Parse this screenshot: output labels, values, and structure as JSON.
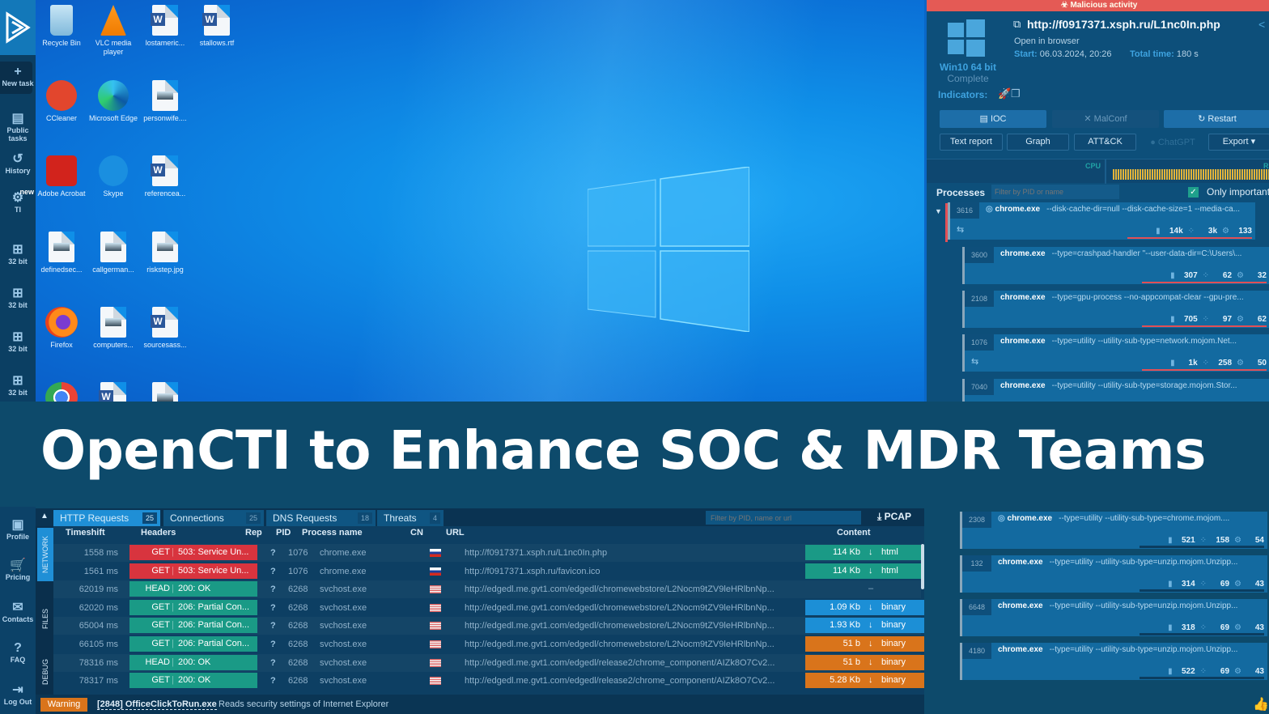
{
  "sidebar": {
    "items": [
      {
        "label": "New task",
        "icon": "plus-icon"
      },
      {
        "label": "Public tasks",
        "icon": "document-icon"
      },
      {
        "label": "History",
        "icon": "history-icon"
      },
      {
        "label": "TI",
        "badge": "new",
        "icon": "ti-icon"
      },
      {
        "label": "32 bit",
        "icon": "windows-icon"
      },
      {
        "label": "32 bit",
        "icon": "windows-icon"
      },
      {
        "label": "32 bit",
        "icon": "windows-icon"
      },
      {
        "label": "32 bit",
        "icon": "windows-icon"
      }
    ],
    "bottom_items": [
      {
        "label": "Profile",
        "icon": "profile-icon"
      },
      {
        "label": "Pricing",
        "icon": "cart-icon"
      },
      {
        "label": "Contacts",
        "icon": "mail-icon"
      },
      {
        "label": "FAQ",
        "icon": "help-icon"
      },
      {
        "label": "Log Out",
        "icon": "logout-icon"
      }
    ]
  },
  "desktop": {
    "icons": [
      {
        "label": "Recycle Bin",
        "type": "recycle"
      },
      {
        "label": "VLC media player",
        "type": "vlc"
      },
      {
        "label": "lostameric...",
        "type": "word"
      },
      {
        "label": "stallows.rtf",
        "type": "word"
      },
      {
        "label": "CCleaner",
        "type": "ccleaner"
      },
      {
        "label": "Microsoft Edge",
        "type": "edge"
      },
      {
        "label": "personwife....",
        "type": "image"
      },
      {
        "label": "Adobe Acrobat",
        "type": "acrobat"
      },
      {
        "label": "Skype",
        "type": "skype"
      },
      {
        "label": "referencea...",
        "type": "word"
      },
      {
        "label": "definedsec...",
        "type": "image"
      },
      {
        "label": "callgerman...",
        "type": "image"
      },
      {
        "label": "riskstep.jpg",
        "type": "image"
      },
      {
        "label": "Firefox",
        "type": "firefox"
      },
      {
        "label": "computers...",
        "type": "image"
      },
      {
        "label": "sourcesass...",
        "type": "word"
      },
      {
        "label": "",
        "type": "chrome"
      },
      {
        "label": "",
        "type": "word"
      },
      {
        "label": "",
        "type": "image"
      }
    ]
  },
  "task": {
    "verdict": "Malicious activity",
    "url": "http://f0917371.xsph.ru/L1nc0In.php",
    "action": "Open in browser",
    "start_label": "Start:",
    "start_value": "06.03.2024, 20:26",
    "total_label": "Total time:",
    "total_value": "180 s",
    "os": "Win10 64 bit",
    "status": "Complete",
    "indicators_label": "Indicators:",
    "buttons": {
      "ioc": "IOC",
      "malconf": "MalConf",
      "restart": "Restart",
      "text_report": "Text report",
      "graph": "Graph",
      "attck": "ATT&CK",
      "chatgpt": "ChatGPT",
      "export": "Export"
    },
    "cpu_label": "CPU",
    "ram_label": "RA"
  },
  "processes": {
    "title": "Processes",
    "filter_placeholder": "Filter by PID or name",
    "only_important_label": "Only important",
    "only_important_checked": true,
    "items": [
      {
        "pid": "3616",
        "name": "chrome.exe",
        "args": "--disk-cache-dir=null --disk-cache-size=1 --media-ca...",
        "files": "14k",
        "reg": "3k",
        "mods": "133"
      },
      {
        "pid": "3600",
        "name": "chrome.exe",
        "args": "--type=crashpad-handler \"--user-data-dir=C:\\Users\\...",
        "files": "307",
        "reg": "62",
        "mods": "32"
      },
      {
        "pid": "2108",
        "name": "chrome.exe",
        "args": "--type=gpu-process --no-appcompat-clear --gpu-pre...",
        "files": "705",
        "reg": "97",
        "mods": "62"
      },
      {
        "pid": "1076",
        "name": "chrome.exe",
        "args": "--type=utility --utility-sub-type=network.mojom.Net...",
        "files": "1k",
        "reg": "258",
        "mods": "50"
      },
      {
        "pid": "7040",
        "name": "chrome.exe",
        "args": "--type=utility --utility-sub-type=storage.mojom.Stor..."
      },
      {
        "pid": "2308",
        "name": "chrome.exe",
        "args": "--type=utility --utility-sub-type=chrome.mojom....",
        "files": "521",
        "reg": "158",
        "mods": "54"
      },
      {
        "pid": "132",
        "name": "chrome.exe",
        "args": "--type=utility --utility-sub-type=unzip.mojom.Unzipp...",
        "files": "314",
        "reg": "69",
        "mods": "43"
      },
      {
        "pid": "6648",
        "name": "chrome.exe",
        "args": "--type=utility --utility-sub-type=unzip.mojom.Unzipp...",
        "files": "318",
        "reg": "69",
        "mods": "43"
      },
      {
        "pid": "4180",
        "name": "chrome.exe",
        "args": "--type=utility --utility-sub-type=unzip.mojom.Unzipp...",
        "files": "522",
        "reg": "69",
        "mods": "43"
      }
    ]
  },
  "headline": "OpenCTI to Enhance SOC & MDR Teams",
  "network": {
    "tabs": [
      {
        "label": "HTTP Requests",
        "count": "25"
      },
      {
        "label": "Connections",
        "count": "25"
      },
      {
        "label": "DNS Requests",
        "count": "18"
      },
      {
        "label": "Threats",
        "count": "4"
      }
    ],
    "side_tabs": [
      "NETWORK",
      "FILES",
      "DEBUG"
    ],
    "filter_placeholder": "Filter by PID, name or url",
    "pcap_label": "PCAP",
    "columns": [
      "Timeshift",
      "Headers",
      "Rep",
      "PID",
      "Process name",
      "CN",
      "URL",
      "Content"
    ],
    "rows": [
      {
        "time": "1558 ms",
        "method": "GET",
        "status": "503: Service Un...",
        "rep": "?",
        "pid": "1076",
        "process": "chrome.exe",
        "cn": "RU",
        "url": "http://f0917371.xsph.ru/L1nc0In.php",
        "size": "114 Kb",
        "type": "html",
        "level": "danger",
        "content_level": "ok"
      },
      {
        "time": "1561 ms",
        "method": "GET",
        "status": "503: Service Un...",
        "rep": "?",
        "pid": "1076",
        "process": "chrome.exe",
        "cn": "RU",
        "url": "http://f0917371.xsph.ru/favicon.ico",
        "size": "114 Kb",
        "type": "html",
        "level": "danger",
        "content_level": "ok"
      },
      {
        "time": "62019 ms",
        "method": "HEAD",
        "status": "200: OK",
        "rep": "?",
        "pid": "6268",
        "process": "svchost.exe",
        "cn": "US",
        "url": "http://edgedl.me.gvt1.com/edgedl/chromewebstore/L2Nocm9tZV9leHRlbnNp...",
        "size": "",
        "type": "–",
        "level": "ok",
        "content_level": "none"
      },
      {
        "time": "62020 ms",
        "method": "GET",
        "status": "206: Partial Con...",
        "rep": "?",
        "pid": "6268",
        "process": "svchost.exe",
        "cn": "US",
        "url": "http://edgedl.me.gvt1.com/edgedl/chromewebstore/L2Nocm9tZV9leHRlbnNp...",
        "size": "1.09 Kb",
        "type": "binary",
        "level": "ok",
        "content_level": "info"
      },
      {
        "time": "65004 ms",
        "method": "GET",
        "status": "206: Partial Con...",
        "rep": "?",
        "pid": "6268",
        "process": "svchost.exe",
        "cn": "US",
        "url": "http://edgedl.me.gvt1.com/edgedl/chromewebstore/L2Nocm9tZV9leHRlbnNp...",
        "size": "1.93 Kb",
        "type": "binary",
        "level": "ok",
        "content_level": "info"
      },
      {
        "time": "66105 ms",
        "method": "GET",
        "status": "206: Partial Con...",
        "rep": "?",
        "pid": "6268",
        "process": "svchost.exe",
        "cn": "US",
        "url": "http://edgedl.me.gvt1.com/edgedl/chromewebstore/L2Nocm9tZV9leHRlbnNp...",
        "size": "51 b",
        "type": "binary",
        "level": "ok",
        "content_level": "warn"
      },
      {
        "time": "78316 ms",
        "method": "HEAD",
        "status": "200: OK",
        "rep": "?",
        "pid": "6268",
        "process": "svchost.exe",
        "cn": "US",
        "url": "http://edgedl.me.gvt1.com/edgedl/release2/chrome_component/AIZk8O7Cv2...",
        "size": "51 b",
        "type": "binary",
        "level": "ok",
        "content_level": "warn"
      },
      {
        "time": "78317 ms",
        "method": "GET",
        "status": "200: OK",
        "rep": "?",
        "pid": "6268",
        "process": "svchost.exe",
        "cn": "US",
        "url": "http://edgedl.me.gvt1.com/edgedl/release2/chrome_component/AIZk8O7Cv2...",
        "size": "5.28 Kb",
        "type": "binary",
        "level": "ok",
        "content_level": "warn"
      }
    ]
  },
  "status_bar": {
    "level": "Warning",
    "process": "[2848] OfficeClickToRun.exe",
    "message": "Reads security settings of Internet Explorer"
  },
  "colors": {
    "danger": "#d8343e",
    "ok": "#1a9a86",
    "info": "#1c8fd6",
    "warn": "#d9741b",
    "malicious_bar": "#e45a55"
  }
}
